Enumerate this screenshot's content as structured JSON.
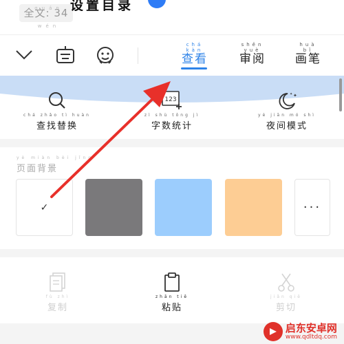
{
  "header": {
    "word_count": "全文: 34",
    "word_count_pinyin": "quán wén",
    "doc_title": "设置目录"
  },
  "toolbar": {
    "icons": [
      "collapse-chevron-icon",
      "keyboard-icon",
      "emoji-icon"
    ],
    "tabs": [
      {
        "label": "查看",
        "pinyin": "chá kàn",
        "active": true
      },
      {
        "label": "审阅",
        "pinyin": "shěn yuè",
        "active": false
      },
      {
        "label": "画笔",
        "pinyin": "huà bǐ",
        "active": false
      }
    ]
  },
  "view_tools": [
    {
      "label": "查找替换",
      "pinyin": "chá zhǎo tì huàn",
      "icon": "search-icon"
    },
    {
      "label": "字数统计",
      "pinyin": "zì shù tǒng jì",
      "icon": "word-count-icon",
      "icon_text": "123"
    },
    {
      "label": "夜间模式",
      "pinyin": "yè jiān mó shì",
      "icon": "night-mode-icon"
    }
  ],
  "page_background": {
    "title": "页面背景",
    "title_pinyin": "yè miàn bèi jǐng",
    "swatches": [
      {
        "name": "white",
        "color": "#ffffff",
        "selected": true,
        "mark": "✓"
      },
      {
        "name": "gray",
        "color": "#7a797b",
        "selected": false
      },
      {
        "name": "blue",
        "color": "#9ccdfd",
        "selected": false
      },
      {
        "name": "orange",
        "color": "#fdcd94",
        "selected": false
      }
    ],
    "more_label": "···"
  },
  "clipboard": [
    {
      "label": "复制",
      "pinyin": "fù zhì",
      "icon": "copy-icon",
      "enabled": false
    },
    {
      "label": "粘贴",
      "pinyin": "zhān tiē",
      "icon": "paste-icon",
      "enabled": true
    },
    {
      "label": "剪切",
      "pinyin": "jiǎn qiē",
      "icon": "scissors-icon",
      "enabled": false
    }
  ],
  "watermark": {
    "name": "启东安卓网",
    "url": "www.qdltdq.com"
  },
  "colors": {
    "accent": "#2e83e8",
    "annotation_arrow": "#e8302a",
    "wave": "#c9ddf6"
  }
}
